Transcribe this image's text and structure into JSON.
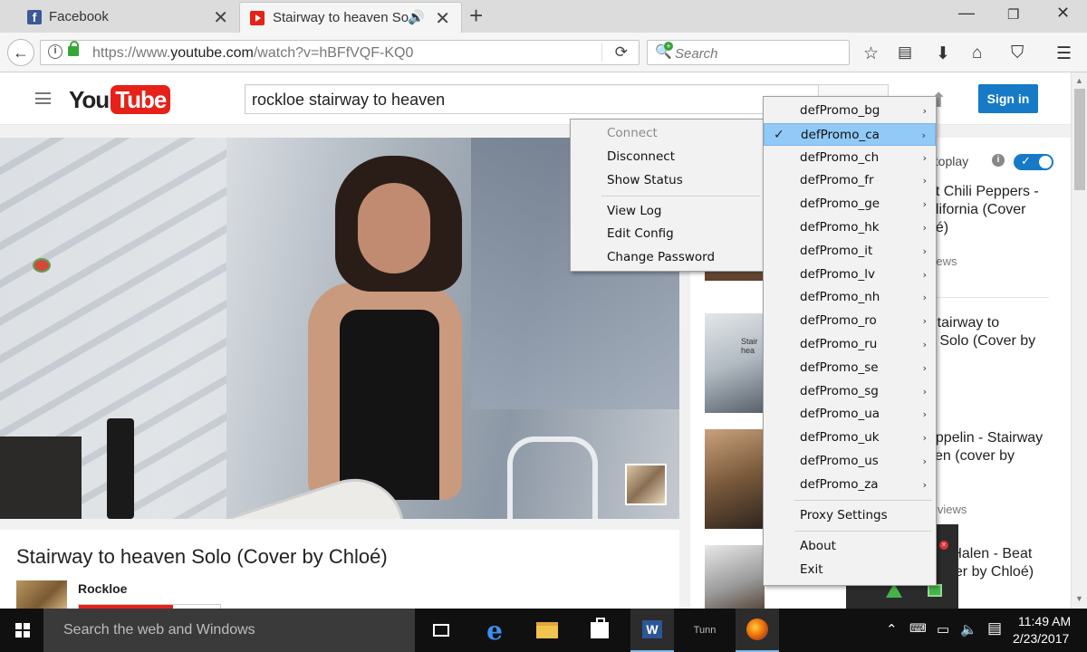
{
  "browser": {
    "tabs": [
      {
        "label": "Facebook",
        "active": false
      },
      {
        "label": "Stairway to heaven So",
        "active": true
      }
    ],
    "url_prefix": "https://www.",
    "url_domain": "youtube.com",
    "url_path": "/watch?v=hBFfVQF-KQ0",
    "search_placeholder": "Search"
  },
  "youtube": {
    "logo_you": "You",
    "logo_tube": "Tube",
    "search_query": "rockloe stairway to heaven",
    "sign_in": "Sign in",
    "video_title": "Stairway to heaven Solo (Cover by Chloé)",
    "channel": "Rockloe",
    "autoplay_label": "utoplay",
    "sidebar": {
      "item1_title": "ot Chili Peppers -\nalifornia (Cover\noé)",
      "item1_meta": "views",
      "item2_title": "Stairway to\nn Solo (Cover by",
      "item2_thumb_text": "Stair\nhea",
      "item3_title": "eppelin - Stairway\nven (cover by",
      "item3_meta": "5 views",
      "item4_title": "n Halen - Beat\nover by Chloé)"
    }
  },
  "menu_main": {
    "items": [
      {
        "label": "Connect",
        "disabled": true
      },
      {
        "label": "Disconnect",
        "disabled": false
      },
      {
        "label": "Show Status",
        "disabled": false
      },
      {
        "label": "View Log",
        "disabled": false
      },
      {
        "label": "Edit Config",
        "disabled": false
      },
      {
        "label": "Change Password",
        "disabled": false
      }
    ]
  },
  "menu_profiles": {
    "selected": "defPromo_ca",
    "items": [
      "defPromo_bg",
      "defPromo_ca",
      "defPromo_ch",
      "defPromo_fr",
      "defPromo_ge",
      "defPromo_hk",
      "defPromo_it",
      "defPromo_lv",
      "defPromo_nh",
      "defPromo_ro",
      "defPromo_ru",
      "defPromo_se",
      "defPromo_sg",
      "defPromo_ua",
      "defPromo_uk",
      "defPromo_us",
      "defPromo_za"
    ],
    "proxy_settings": "Proxy Settings",
    "about": "About",
    "exit": "Exit"
  },
  "taskbar": {
    "search_placeholder": "Search the web and Windows",
    "tunnel_label": "Tunn",
    "time": "11:49 AM",
    "date": "2/23/2017"
  },
  "colors": {
    "youtube_red": "#e62117",
    "signin_blue": "#167ac6",
    "menu_highlight": "#91c9f7"
  }
}
